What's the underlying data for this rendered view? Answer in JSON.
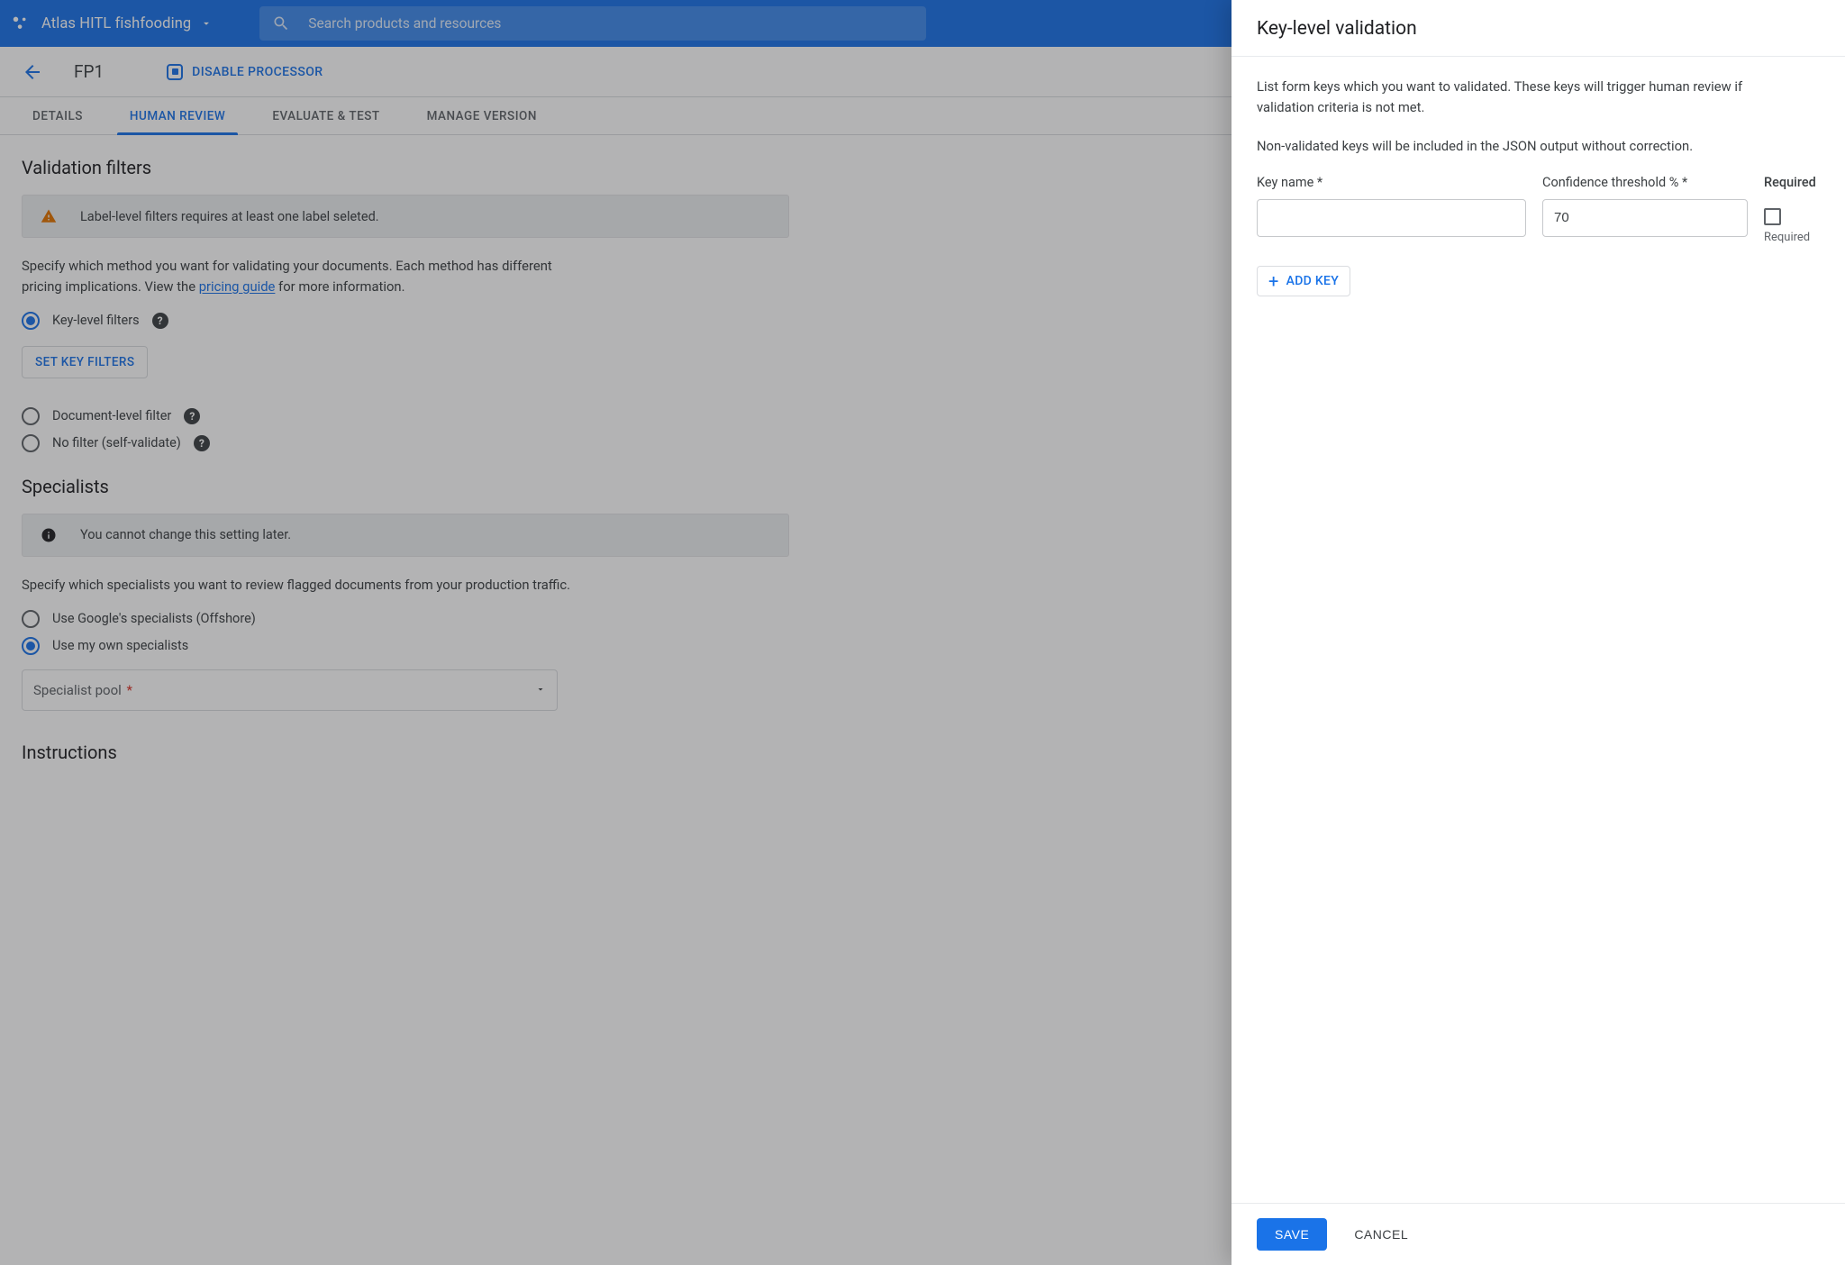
{
  "header": {
    "project": "Atlas HITL fishfooding",
    "search_placeholder": "Search products and resources"
  },
  "subheader": {
    "back_aria": "Back",
    "title": "FP1",
    "disable_label": "DISABLE PROCESSOR"
  },
  "tabs": {
    "details": "DETAILS",
    "human_review": "HUMAN REVIEW",
    "evaluate": "EVALUATE & TEST",
    "manage": "MANAGE VERSION"
  },
  "validation": {
    "heading": "Validation filters",
    "warning": "Label-level filters requires at least one label seleted.",
    "desc_pre": "Specify which method you want for validating your documents. Each method has different pricing implications. View the ",
    "desc_link": "pricing guide",
    "desc_post": " for more information.",
    "radio_key": "Key-level filters",
    "set_key_btn": "SET KEY FILTERS",
    "radio_doc": "Document-level filter",
    "radio_none": "No filter (self-validate)"
  },
  "specialists": {
    "heading": "Specialists",
    "info": "You cannot change this setting later.",
    "desc": "Specify which specialists you want to review flagged documents from your production traffic.",
    "radio_google": "Use Google's specialists (Offshore)",
    "radio_own": "Use my own specialists",
    "pool_placeholder": "Specialist pool",
    "instructions_heading": "Instructions"
  },
  "panel": {
    "title": "Key-level validation",
    "p1": "List form keys which you want to validated. These keys will trigger human review if validation criteria is not met.",
    "p2": "Non-validated keys will be included in the JSON output without correction.",
    "labels": {
      "key_name": "Key name *",
      "confidence": "Confidence threshold % *",
      "required_header": "Required",
      "required_sub": "Required"
    },
    "fields": {
      "key_name_value": "",
      "confidence_value": "70"
    },
    "add_key": "ADD KEY",
    "save": "SAVE",
    "cancel": "CANCEL"
  }
}
